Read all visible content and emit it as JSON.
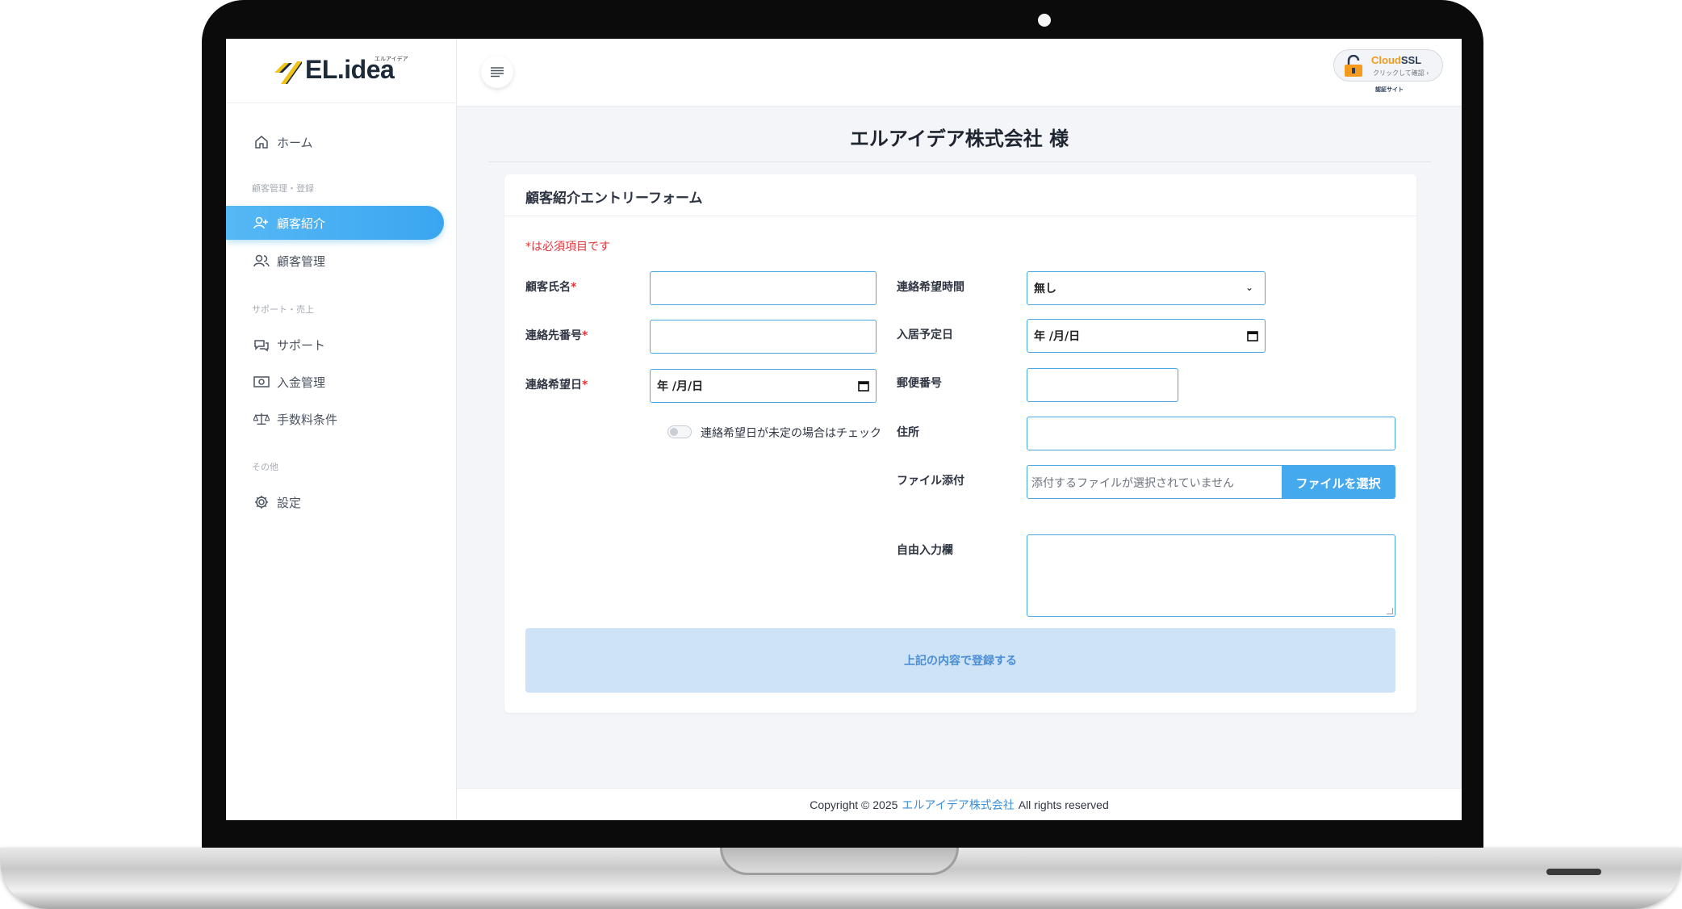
{
  "brand": {
    "logo_text": "EL.idea",
    "logo_sub": "エルアイデア",
    "accent": "#45a9ed"
  },
  "sidebar": {
    "home": "ホーム",
    "section1": "顧客管理・登録",
    "customer_referral": "顧客紹介",
    "customer_management": "顧客管理",
    "section2": "サポート・売上",
    "support": "サポート",
    "payment": "入金管理",
    "fee": "手数料条件",
    "section3": "その他",
    "settings": "設定"
  },
  "header": {
    "ssl_title_a": "Cloud",
    "ssl_title_b": "SSL",
    "ssl_sub": "クリックして確認 ›",
    "ssl_caption": "認証サイト"
  },
  "page": {
    "title": "エルアイデア株式会社 様"
  },
  "form": {
    "card_title": "顧客紹介エントリーフォーム",
    "required_note": "*は必須項目です",
    "required_mark": "*",
    "name_label": "顧客氏名",
    "phone_label": "連絡先番号",
    "contact_date_label": "連絡希望日",
    "contact_date_value": "年 /月/日",
    "undecided_label": "連絡希望日が未定の場合はチェック",
    "contact_time_label": "連絡希望時間",
    "contact_time_value": "無し",
    "move_in_label": "入居予定日",
    "move_in_value": "年 /月/日",
    "postal_label": "郵便番号",
    "address_label": "住所",
    "file_label": "ファイル添付",
    "file_placeholder": "添付するファイルが選択されていません",
    "file_button": "ファイルを選択",
    "free_label": "自由入力欄",
    "submit": "上記の内容で登録する"
  },
  "footer": {
    "prefix": "Copyright © 2025",
    "company": "エルアイデア株式会社",
    "suffix": "All rights reserved"
  }
}
